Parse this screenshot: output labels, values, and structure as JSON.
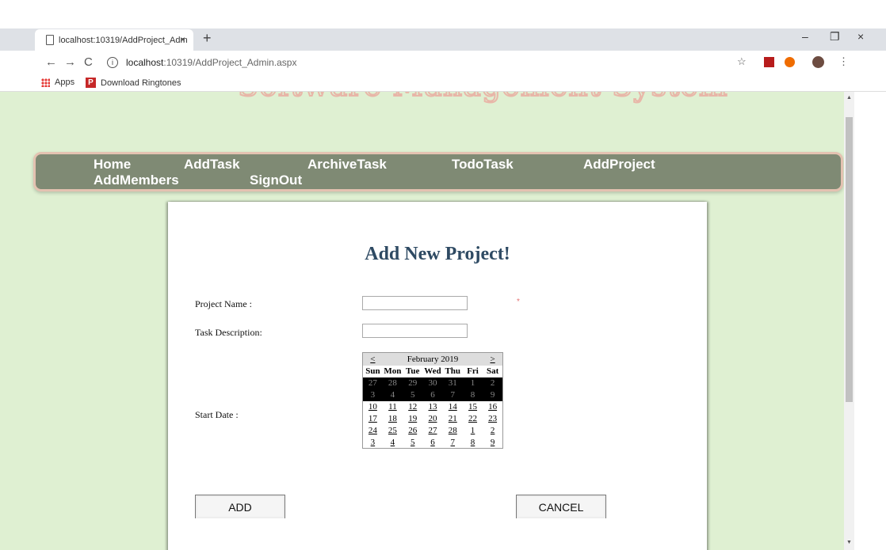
{
  "browser": {
    "tab_title": "localhost:10319/AddProject_Adm",
    "tab_close": "×",
    "new_tab": "+",
    "url_host": "localhost",
    "url_rest": ":10319/AddProject_Admin.aspx",
    "win_min": "–",
    "win_max": "❐",
    "win_close": "×",
    "nav_back": "←",
    "nav_forward": "→",
    "nav_reload": "C",
    "info": "i",
    "star": "☆",
    "menu_dots": "⋮",
    "bookmarks": [
      {
        "label": "Apps"
      },
      {
        "label": "Download Ringtones"
      }
    ]
  },
  "site": {
    "banner": "Software Management System",
    "menu": [
      "Home",
      "AddTask",
      "ArchiveTask",
      "TodoTask",
      "AddProject",
      "AddMembers",
      "SignOut"
    ]
  },
  "form": {
    "heading": "Add New Project!",
    "project_name_label": "Project Name :",
    "task_description_label": "Task Description:",
    "start_date_label": "Start Date :",
    "required_mark": "*",
    "project_name_value": "",
    "task_description_value": "",
    "add_button": "ADD",
    "cancel_button": "CANCEL"
  },
  "calendar": {
    "prev": "<",
    "next": ">",
    "month": "February 2019",
    "days": [
      "Sun",
      "Mon",
      "Tue",
      "Wed",
      "Thu",
      "Fri",
      "Sat"
    ],
    "weeks": [
      [
        "27",
        "28",
        "29",
        "30",
        "31",
        "1",
        "2"
      ],
      [
        "3",
        "4",
        "5",
        "6",
        "7",
        "8",
        "9"
      ],
      [
        "10",
        "11",
        "12",
        "13",
        "14",
        "15",
        "16"
      ],
      [
        "17",
        "18",
        "19",
        "20",
        "21",
        "22",
        "23"
      ],
      [
        "24",
        "25",
        "26",
        "27",
        "28",
        "1",
        "2"
      ],
      [
        "3",
        "4",
        "5",
        "6",
        "7",
        "8",
        "9"
      ]
    ],
    "disabled_weeks": [
      0,
      1
    ]
  }
}
